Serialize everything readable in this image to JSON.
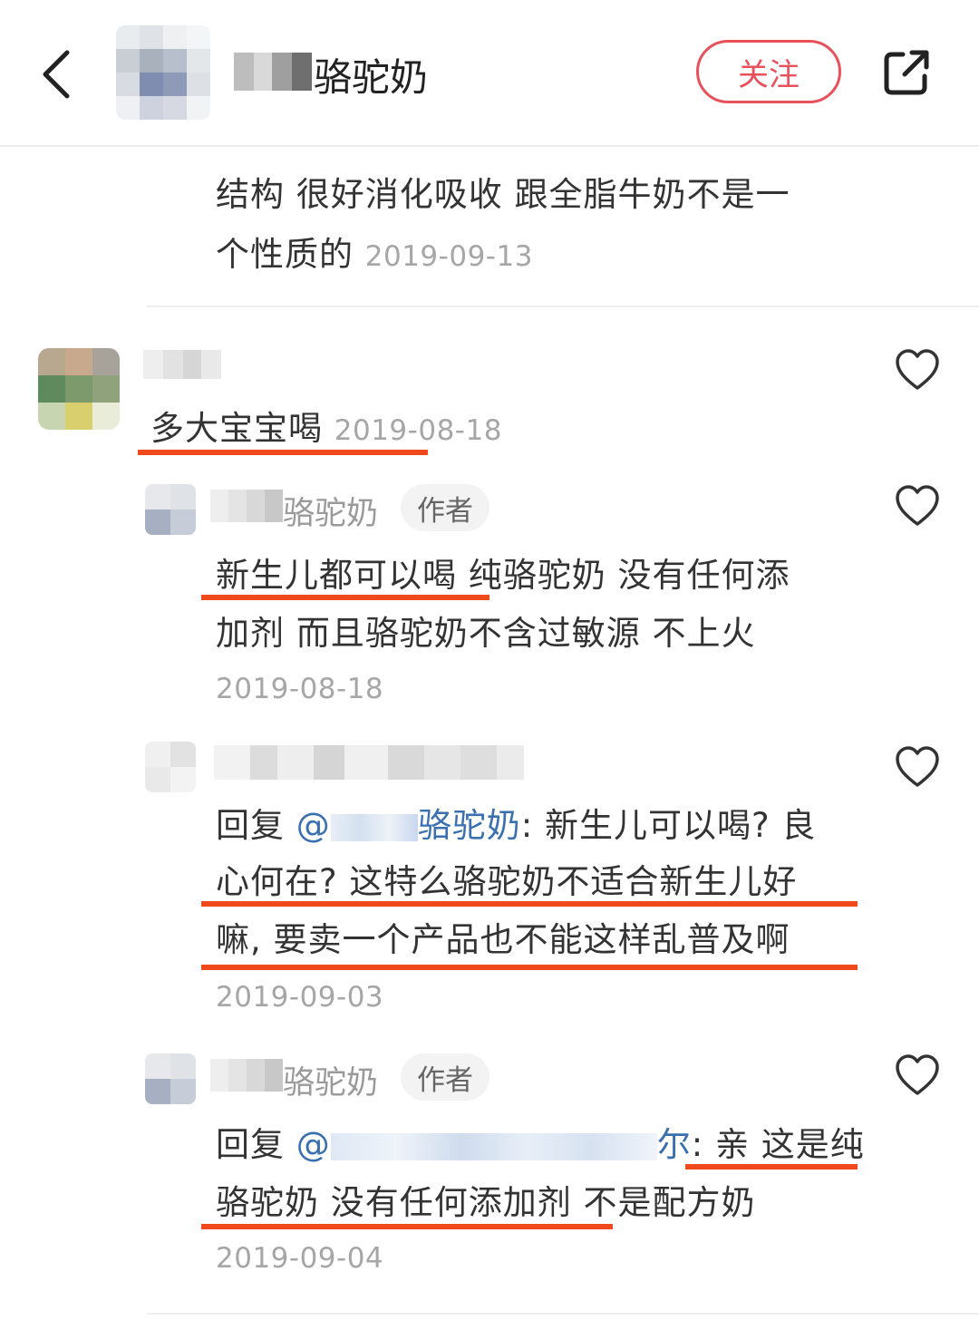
{
  "header": {
    "nickname_suffix": "骆驼奶",
    "follow_label": "关注"
  },
  "top_comment": {
    "line1": "结构 很好消化吸收 跟全脂牛奶不是一",
    "line2": "个性质的",
    "date": "2019-09-13"
  },
  "comment": {
    "text": "多大宝宝喝",
    "date": "2019-08-18"
  },
  "replies": [
    {
      "name_suffix": "骆驼奶",
      "tag": "作者",
      "line1": "新生儿都可以喝 纯骆驼奶 没有任何添",
      "line2": "加剂 而且骆驼奶不含过敏源 不上火",
      "date": "2019-08-18"
    },
    {
      "reply_prefix": "回复",
      "mention_at": "@",
      "mention_suffix": "骆驼奶",
      "line1_rest": ": 新生儿可以喝? 良",
      "line2": "心何在? 这特么骆驼奶不适合新生儿好",
      "line3": "嘛, 要卖一个产品也不能这样乱普及啊",
      "date": "2019-09-03"
    },
    {
      "name_suffix": "骆驼奶",
      "tag": "作者",
      "reply_prefix": "回复",
      "mention_at": "@",
      "mention_tail": "尔",
      "line1_rest": ": 亲 这是纯",
      "line2": "骆驼奶 没有任何添加剂 不是配方奶",
      "date": "2019-09-04"
    }
  ],
  "colors": {
    "follow": "#e8505b",
    "underline": "#f04a1c",
    "mention": "#3a6fb0"
  },
  "icons": [
    "back-chevron-icon",
    "share-icon",
    "heart-icon"
  ]
}
